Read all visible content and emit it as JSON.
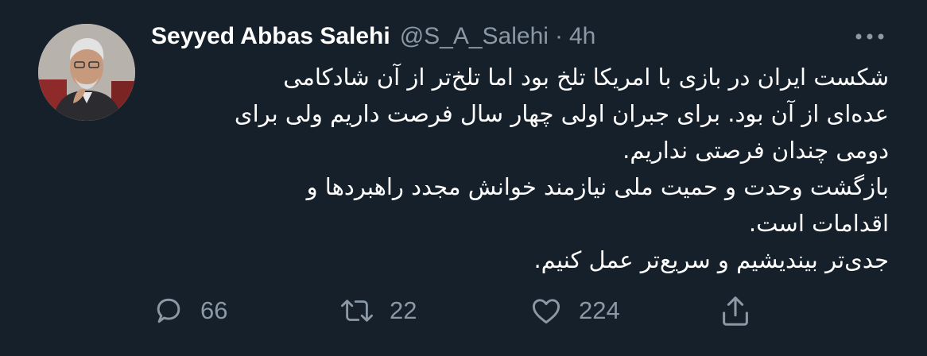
{
  "tweet": {
    "author": {
      "name": "Seyyed Abbas Salehi",
      "handle": "@S_A_Salehi",
      "separator": "·",
      "time": "4h"
    },
    "more_icon": "ellipsis-icon",
    "text_lines": [
      "شکست ایران در بازی با امریکا تلخ بود اما تلخ‌تر از آن شادکامی",
      "عده‌ای از آن بود. برای جبران اولی چهار سال فرصت داریم ولی برای",
      "دومی چندان فرصتی نداریم.",
      " بازگشت وحدت و حمیت ملی نیازمند خوانش مجدد راهبردها و",
      "اقدامات است.",
      "جدی‌تر بیندیشیم و سریع‌تر عمل کنیم."
    ],
    "actions": {
      "reply": {
        "icon": "reply-icon",
        "count": "66"
      },
      "retweet": {
        "icon": "retweet-icon",
        "count": "22"
      },
      "like": {
        "icon": "heart-icon",
        "count": "224"
      },
      "share": {
        "icon": "share-icon"
      }
    }
  },
  "colors": {
    "background": "#15202b",
    "text_primary": "#ffffff",
    "text_secondary": "#8b98a5"
  }
}
